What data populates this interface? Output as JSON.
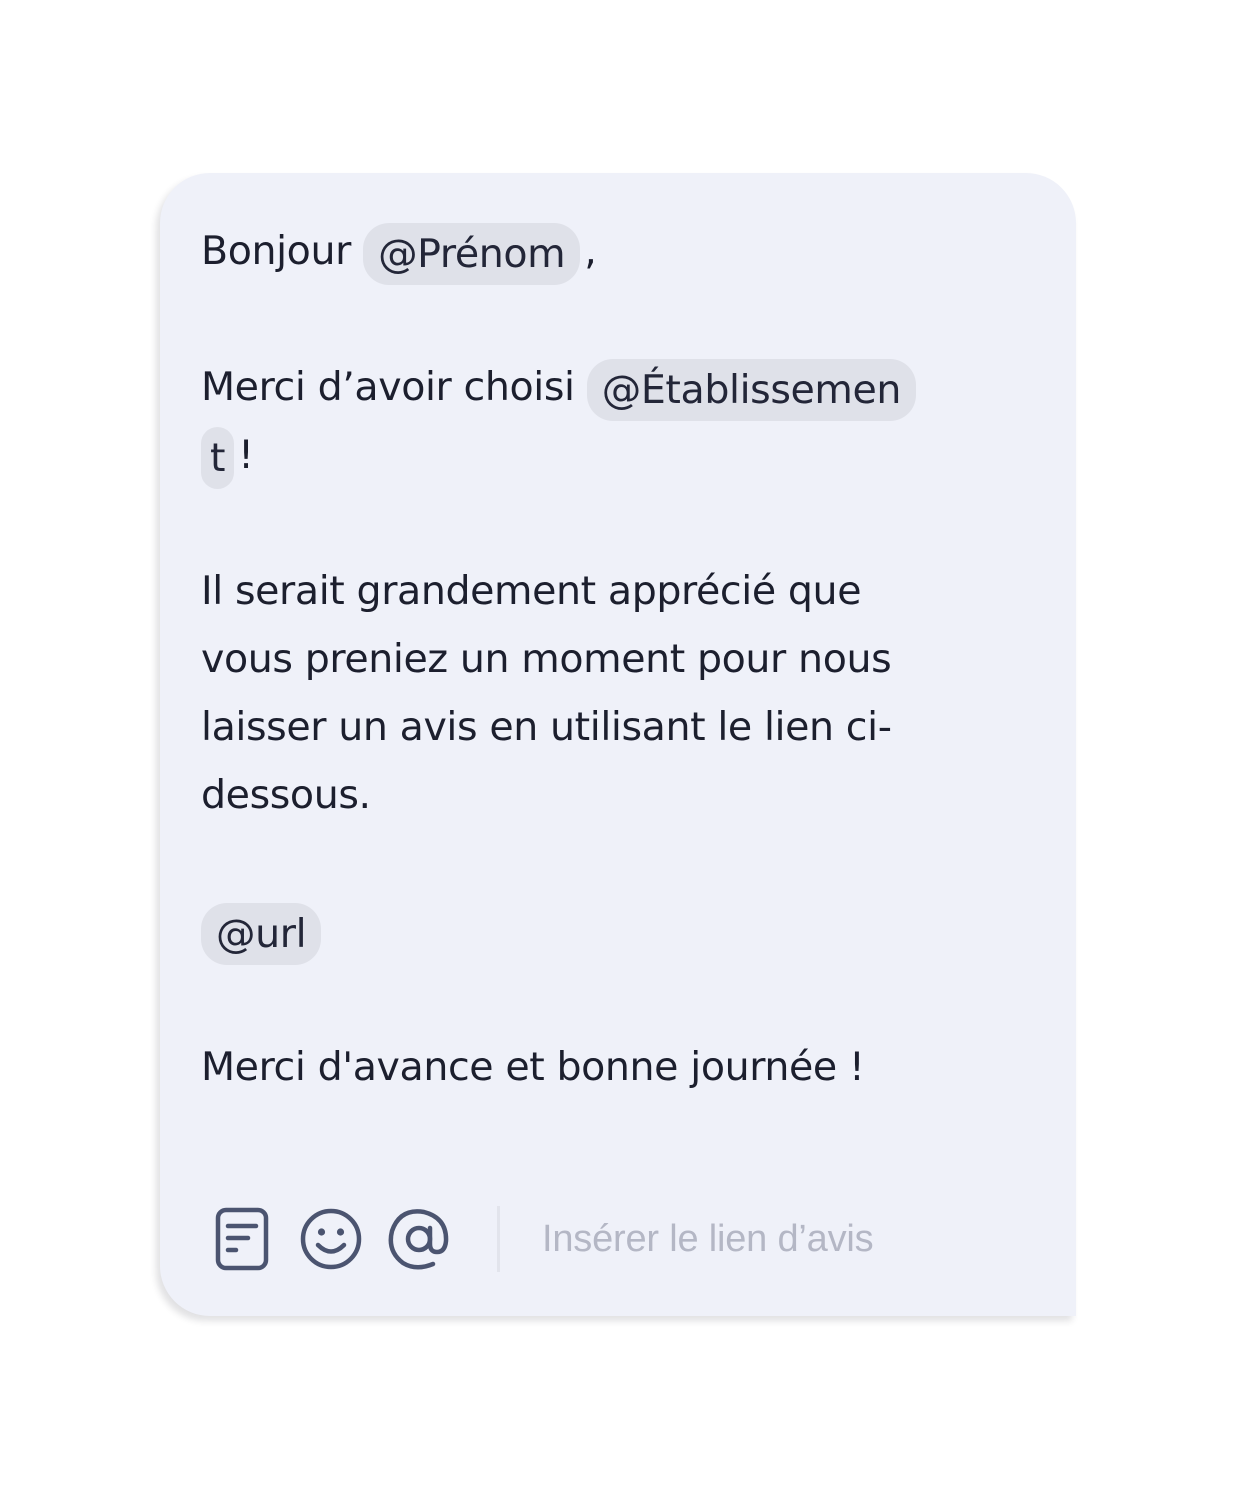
{
  "message": {
    "greeting": "Bonjour",
    "greeting_mention": "@Prénom",
    "greeting_punct": ",",
    "thanks_prefix": "Merci d’avoir choisi",
    "thanks_mention_line1": "@Établissemen",
    "thanks_mention_line2": "t",
    "thanks_punct": "!",
    "request_lines": [
      "Il serait grandement apprécié que",
      "vous preniez un moment pour nous",
      "laisser un avis en utilisant le lien ci-",
      "dessous."
    ],
    "url_mention": "@url",
    "closing": "Merci d'avance et bonne journée !"
  },
  "toolbar": {
    "icons": [
      "template-icon",
      "emoji-icon",
      "mention-icon"
    ],
    "insert_link_label": "Insérer le lien d’avis"
  },
  "colors": {
    "card_background": "#eff1f9",
    "mention_background": "#dfe1e9",
    "text": "#1c1f2e",
    "icon": "#4b5470",
    "placeholder": "#b4b7c5"
  }
}
